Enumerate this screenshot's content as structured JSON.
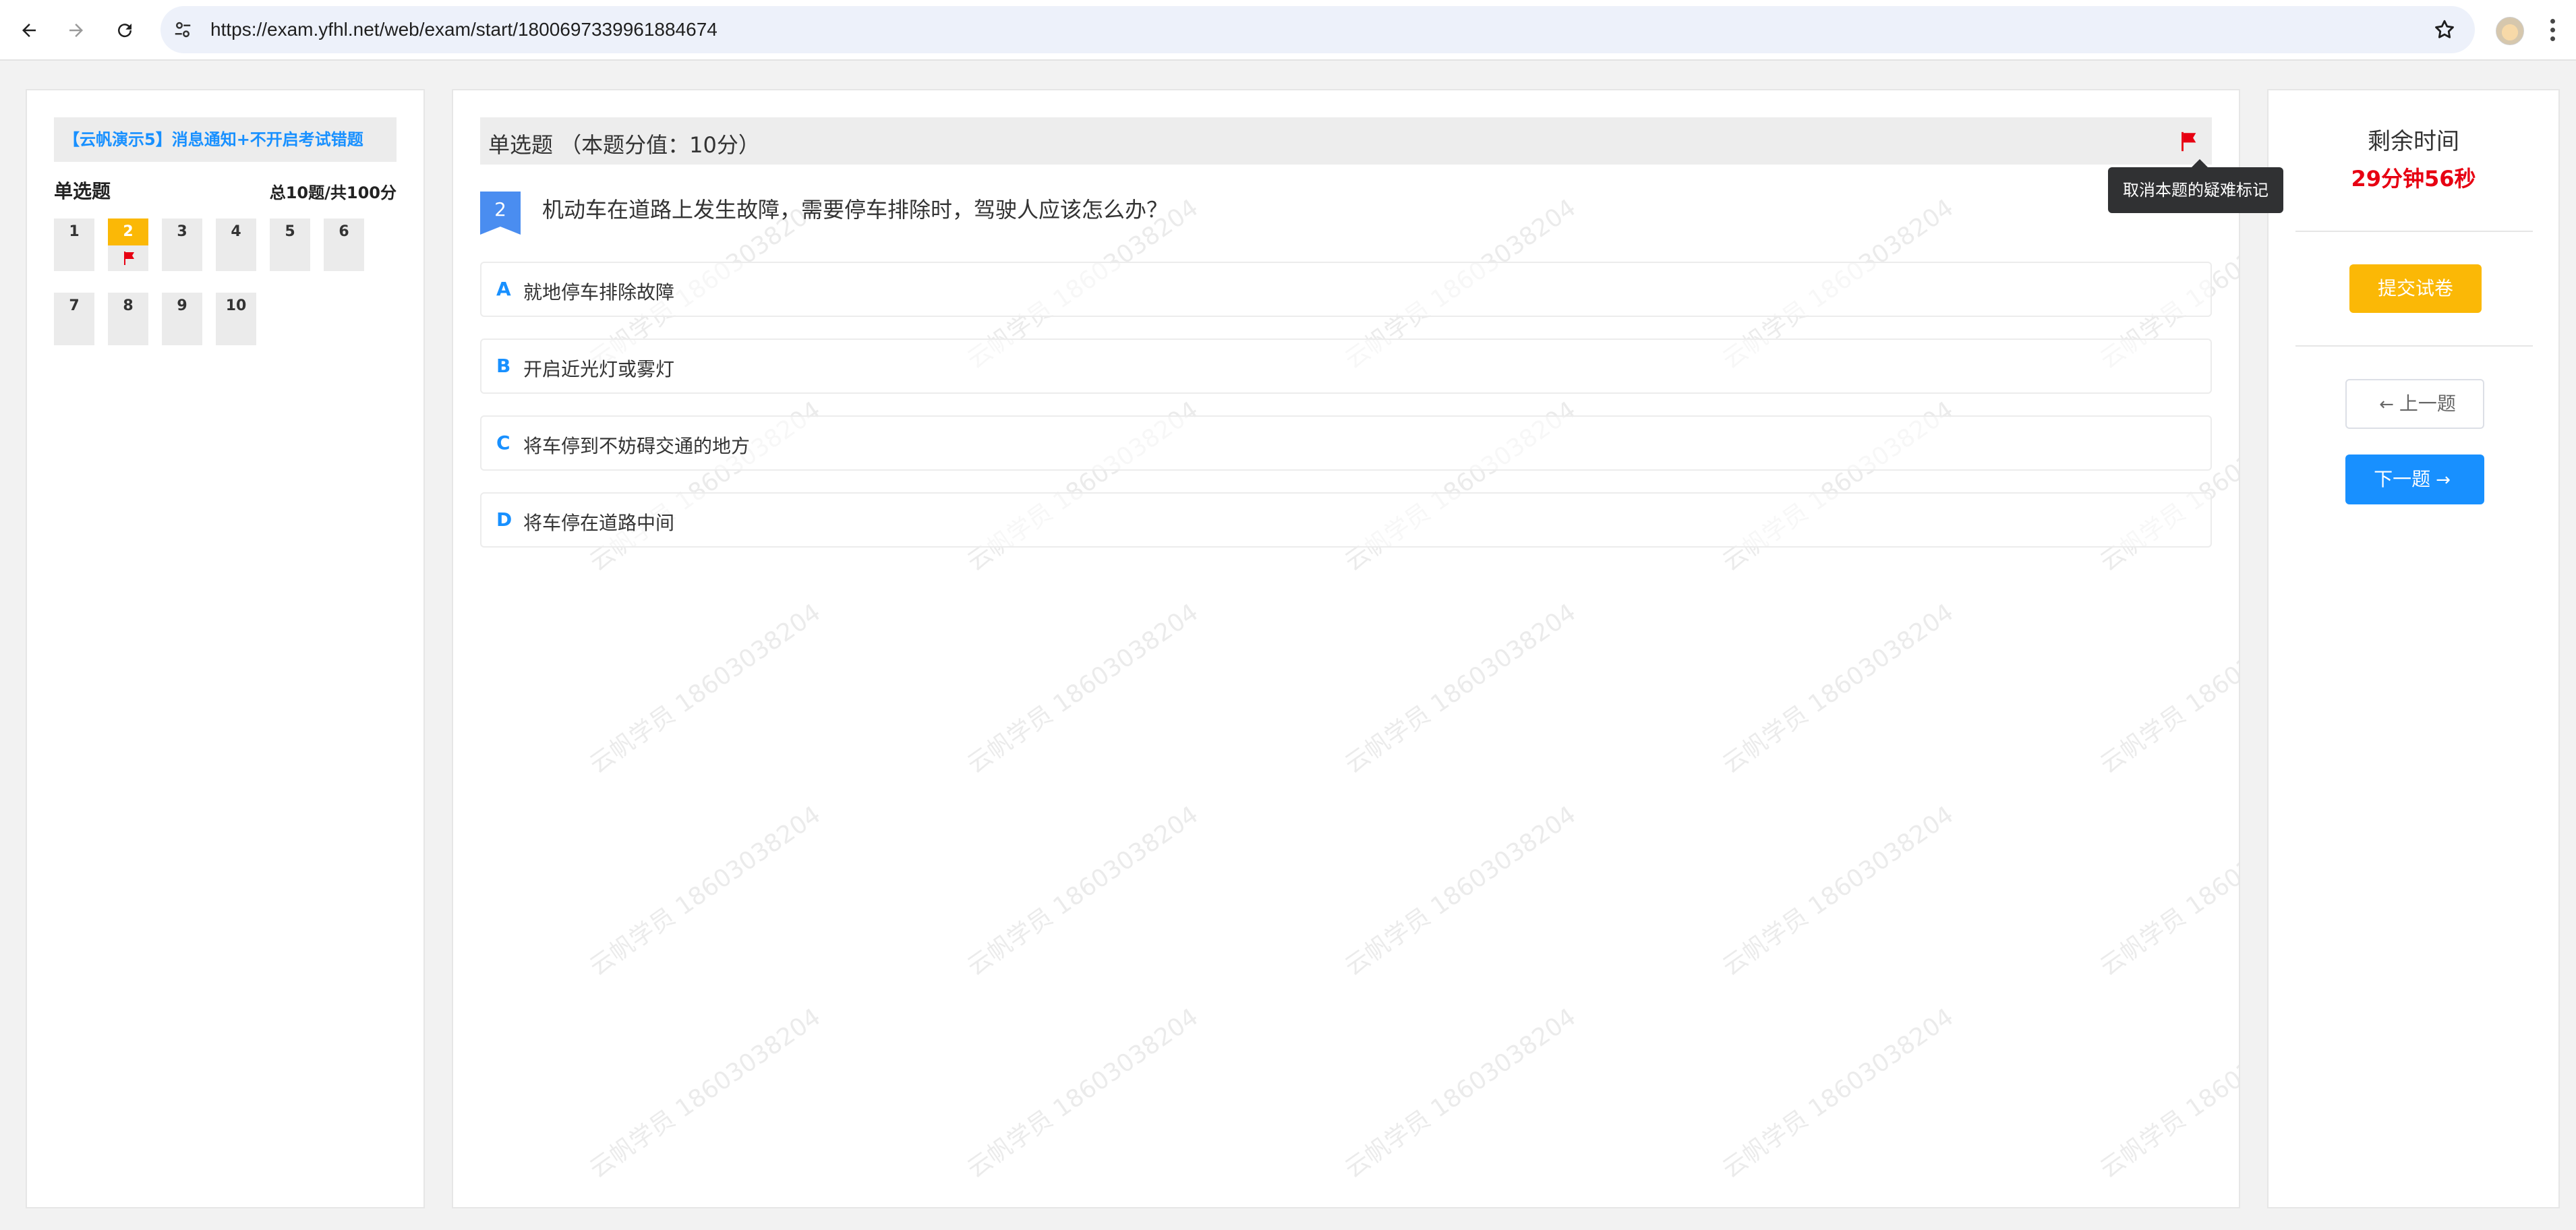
{
  "browser": {
    "url": "https://exam.yfhl.net/web/exam/start/1800697339961884674"
  },
  "left_panel": {
    "exam_title": "【云帆演示5】消息通知+不开启考试错题",
    "section_name": "单选题",
    "section_meta": "总10题/共100分",
    "questions": [
      "1",
      "2",
      "3",
      "4",
      "5",
      "6",
      "7",
      "8",
      "9",
      "10"
    ],
    "current_question": "2",
    "flagged_questions": [
      "2"
    ]
  },
  "question": {
    "header": "单选题 （本题分值：10分）",
    "number": "2",
    "stem": "机动车在道路上发生故障，需要停车排除时，驾驶人应该怎么办？",
    "flag_tooltip": "取消本题的疑难标记",
    "options": [
      {
        "letter": "A",
        "text": "就地停车排除故障"
      },
      {
        "letter": "B",
        "text": "开启近光灯或雾灯"
      },
      {
        "letter": "C",
        "text": "将车停到不妨碍交通的地方"
      },
      {
        "letter": "D",
        "text": "将车停在道路中间"
      }
    ]
  },
  "watermark": "云帆学员 18603038204",
  "right_panel": {
    "time_label": "剩余时间",
    "time_value": "29分钟56秒",
    "submit_label": "提交试卷",
    "prev_label": "上一题",
    "next_label": "下一题"
  },
  "colors": {
    "accent_blue": "#1890ff",
    "highlight_yellow": "#fbb806",
    "flag_red": "#e70012",
    "badge_blue": "#4a8df0"
  },
  "icons": [
    "back-arrow-icon",
    "forward-arrow-icon",
    "reload-icon",
    "site-settings-icon",
    "star-icon",
    "profile-avatar-icon",
    "more-menu-icon",
    "flag-icon",
    "arrow-left-icon",
    "arrow-right-icon"
  ]
}
